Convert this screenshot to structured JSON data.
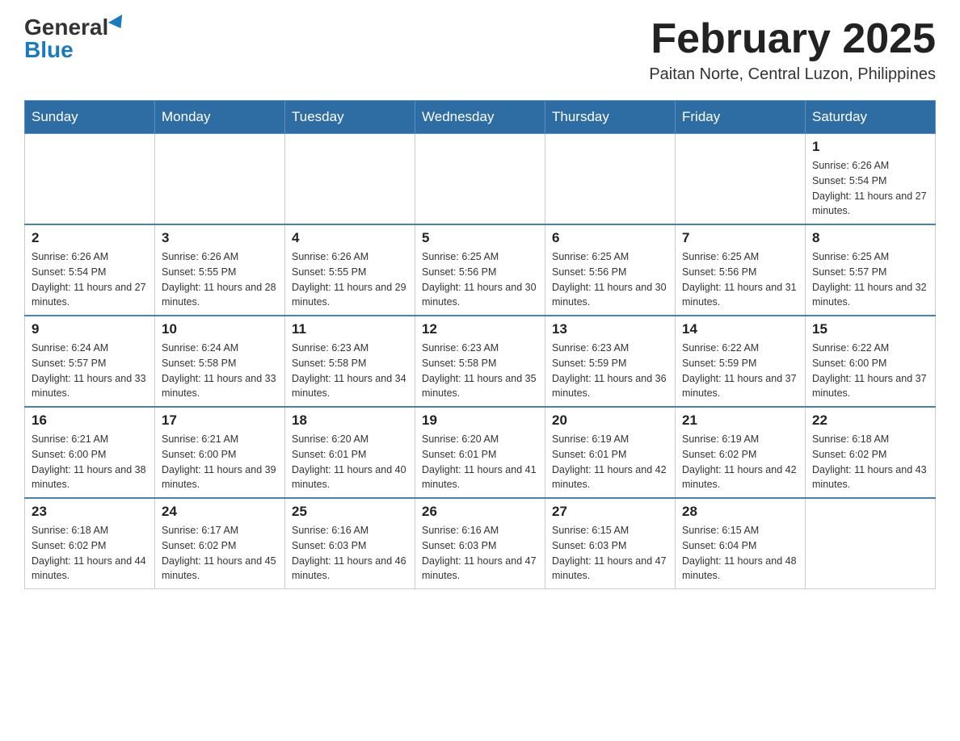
{
  "header": {
    "logo_text_general": "General",
    "logo_text_blue": "Blue",
    "month_title": "February 2025",
    "subtitle": "Paitan Norte, Central Luzon, Philippines"
  },
  "days_of_week": [
    "Sunday",
    "Monday",
    "Tuesday",
    "Wednesday",
    "Thursday",
    "Friday",
    "Saturday"
  ],
  "weeks": [
    [
      {
        "day": "",
        "sunrise": "",
        "sunset": "",
        "daylight": ""
      },
      {
        "day": "",
        "sunrise": "",
        "sunset": "",
        "daylight": ""
      },
      {
        "day": "",
        "sunrise": "",
        "sunset": "",
        "daylight": ""
      },
      {
        "day": "",
        "sunrise": "",
        "sunset": "",
        "daylight": ""
      },
      {
        "day": "",
        "sunrise": "",
        "sunset": "",
        "daylight": ""
      },
      {
        "day": "",
        "sunrise": "",
        "sunset": "",
        "daylight": ""
      },
      {
        "day": "1",
        "sunrise": "Sunrise: 6:26 AM",
        "sunset": "Sunset: 5:54 PM",
        "daylight": "Daylight: 11 hours and 27 minutes."
      }
    ],
    [
      {
        "day": "2",
        "sunrise": "Sunrise: 6:26 AM",
        "sunset": "Sunset: 5:54 PM",
        "daylight": "Daylight: 11 hours and 27 minutes."
      },
      {
        "day": "3",
        "sunrise": "Sunrise: 6:26 AM",
        "sunset": "Sunset: 5:55 PM",
        "daylight": "Daylight: 11 hours and 28 minutes."
      },
      {
        "day": "4",
        "sunrise": "Sunrise: 6:26 AM",
        "sunset": "Sunset: 5:55 PM",
        "daylight": "Daylight: 11 hours and 29 minutes."
      },
      {
        "day": "5",
        "sunrise": "Sunrise: 6:25 AM",
        "sunset": "Sunset: 5:56 PM",
        "daylight": "Daylight: 11 hours and 30 minutes."
      },
      {
        "day": "6",
        "sunrise": "Sunrise: 6:25 AM",
        "sunset": "Sunset: 5:56 PM",
        "daylight": "Daylight: 11 hours and 30 minutes."
      },
      {
        "day": "7",
        "sunrise": "Sunrise: 6:25 AM",
        "sunset": "Sunset: 5:56 PM",
        "daylight": "Daylight: 11 hours and 31 minutes."
      },
      {
        "day": "8",
        "sunrise": "Sunrise: 6:25 AM",
        "sunset": "Sunset: 5:57 PM",
        "daylight": "Daylight: 11 hours and 32 minutes."
      }
    ],
    [
      {
        "day": "9",
        "sunrise": "Sunrise: 6:24 AM",
        "sunset": "Sunset: 5:57 PM",
        "daylight": "Daylight: 11 hours and 33 minutes."
      },
      {
        "day": "10",
        "sunrise": "Sunrise: 6:24 AM",
        "sunset": "Sunset: 5:58 PM",
        "daylight": "Daylight: 11 hours and 33 minutes."
      },
      {
        "day": "11",
        "sunrise": "Sunrise: 6:23 AM",
        "sunset": "Sunset: 5:58 PM",
        "daylight": "Daylight: 11 hours and 34 minutes."
      },
      {
        "day": "12",
        "sunrise": "Sunrise: 6:23 AM",
        "sunset": "Sunset: 5:58 PM",
        "daylight": "Daylight: 11 hours and 35 minutes."
      },
      {
        "day": "13",
        "sunrise": "Sunrise: 6:23 AM",
        "sunset": "Sunset: 5:59 PM",
        "daylight": "Daylight: 11 hours and 36 minutes."
      },
      {
        "day": "14",
        "sunrise": "Sunrise: 6:22 AM",
        "sunset": "Sunset: 5:59 PM",
        "daylight": "Daylight: 11 hours and 37 minutes."
      },
      {
        "day": "15",
        "sunrise": "Sunrise: 6:22 AM",
        "sunset": "Sunset: 6:00 PM",
        "daylight": "Daylight: 11 hours and 37 minutes."
      }
    ],
    [
      {
        "day": "16",
        "sunrise": "Sunrise: 6:21 AM",
        "sunset": "Sunset: 6:00 PM",
        "daylight": "Daylight: 11 hours and 38 minutes."
      },
      {
        "day": "17",
        "sunrise": "Sunrise: 6:21 AM",
        "sunset": "Sunset: 6:00 PM",
        "daylight": "Daylight: 11 hours and 39 minutes."
      },
      {
        "day": "18",
        "sunrise": "Sunrise: 6:20 AM",
        "sunset": "Sunset: 6:01 PM",
        "daylight": "Daylight: 11 hours and 40 minutes."
      },
      {
        "day": "19",
        "sunrise": "Sunrise: 6:20 AM",
        "sunset": "Sunset: 6:01 PM",
        "daylight": "Daylight: 11 hours and 41 minutes."
      },
      {
        "day": "20",
        "sunrise": "Sunrise: 6:19 AM",
        "sunset": "Sunset: 6:01 PM",
        "daylight": "Daylight: 11 hours and 42 minutes."
      },
      {
        "day": "21",
        "sunrise": "Sunrise: 6:19 AM",
        "sunset": "Sunset: 6:02 PM",
        "daylight": "Daylight: 11 hours and 42 minutes."
      },
      {
        "day": "22",
        "sunrise": "Sunrise: 6:18 AM",
        "sunset": "Sunset: 6:02 PM",
        "daylight": "Daylight: 11 hours and 43 minutes."
      }
    ],
    [
      {
        "day": "23",
        "sunrise": "Sunrise: 6:18 AM",
        "sunset": "Sunset: 6:02 PM",
        "daylight": "Daylight: 11 hours and 44 minutes."
      },
      {
        "day": "24",
        "sunrise": "Sunrise: 6:17 AM",
        "sunset": "Sunset: 6:02 PM",
        "daylight": "Daylight: 11 hours and 45 minutes."
      },
      {
        "day": "25",
        "sunrise": "Sunrise: 6:16 AM",
        "sunset": "Sunset: 6:03 PM",
        "daylight": "Daylight: 11 hours and 46 minutes."
      },
      {
        "day": "26",
        "sunrise": "Sunrise: 6:16 AM",
        "sunset": "Sunset: 6:03 PM",
        "daylight": "Daylight: 11 hours and 47 minutes."
      },
      {
        "day": "27",
        "sunrise": "Sunrise: 6:15 AM",
        "sunset": "Sunset: 6:03 PM",
        "daylight": "Daylight: 11 hours and 47 minutes."
      },
      {
        "day": "28",
        "sunrise": "Sunrise: 6:15 AM",
        "sunset": "Sunset: 6:04 PM",
        "daylight": "Daylight: 11 hours and 48 minutes."
      },
      {
        "day": "",
        "sunrise": "",
        "sunset": "",
        "daylight": ""
      }
    ]
  ]
}
